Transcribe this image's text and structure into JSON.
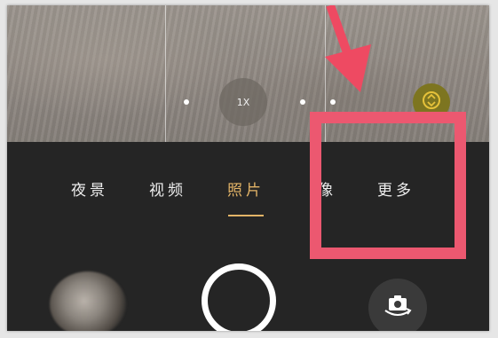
{
  "zoom": {
    "label": "1X"
  },
  "modes": [
    {
      "label": "夜景",
      "active": false
    },
    {
      "label": "视频",
      "active": false
    },
    {
      "label": "照片",
      "active": true
    },
    {
      "label": "像",
      "active": false
    },
    {
      "label": "更多",
      "active": false
    }
  ],
  "colors": {
    "active_mode": "#e3b467",
    "highlight": "#ec5870",
    "arrow": "#ee4a62",
    "lens_button": "#7d7520"
  },
  "icons": {
    "lens": "lens-switch-icon",
    "flip": "camera-flip-icon"
  }
}
